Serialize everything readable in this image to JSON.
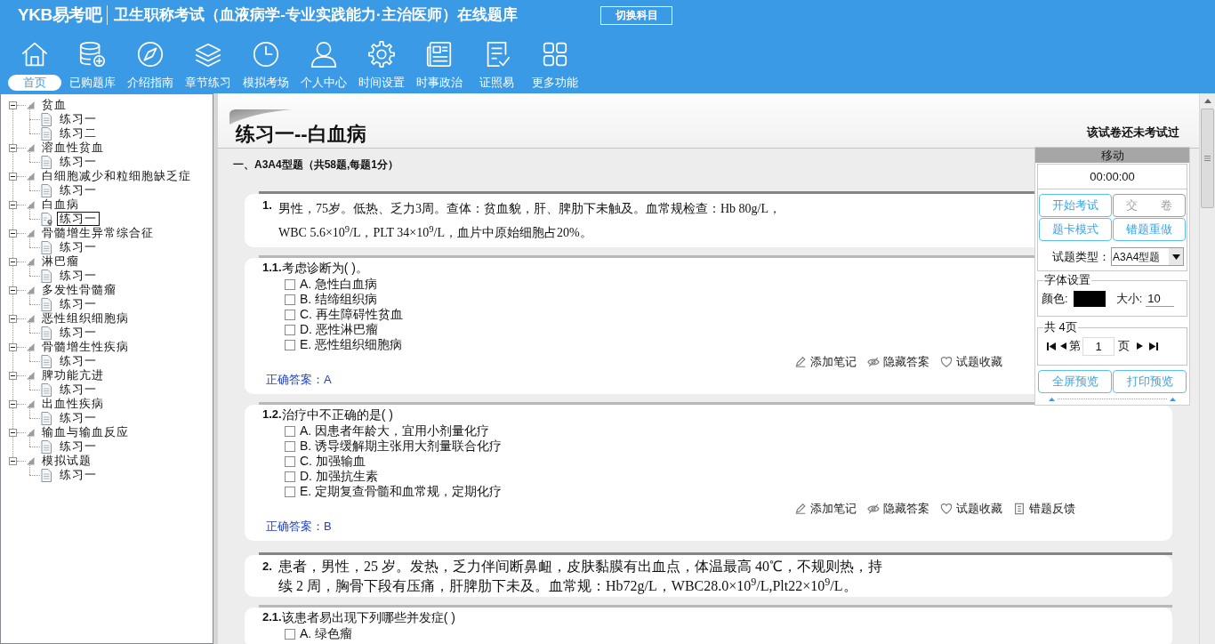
{
  "header": {
    "logo": "YKB易考吧",
    "title": "卫生职称考试（血液病学-专业实践能力·主治医师）在线题库",
    "switch_button": "切换科目"
  },
  "nav": [
    {
      "label": "首页",
      "selected": true
    },
    {
      "label": "已购题库",
      "selected": false
    },
    {
      "label": "介绍指南",
      "selected": false
    },
    {
      "label": "章节练习",
      "selected": false
    },
    {
      "label": "模拟考场",
      "selected": false
    },
    {
      "label": "个人中心",
      "selected": false
    },
    {
      "label": "时间设置",
      "selected": false
    },
    {
      "label": "时事政治",
      "selected": false
    },
    {
      "label": "证照易",
      "selected": false
    },
    {
      "label": "更多功能",
      "selected": false
    }
  ],
  "tree": [
    {
      "label": "贫血",
      "expanded": true,
      "children": [
        {
          "label": "练习一",
          "selected": false
        },
        {
          "label": "练习二",
          "selected": false
        }
      ]
    },
    {
      "label": "溶血性贫血",
      "expanded": true,
      "children": [
        {
          "label": "练习一",
          "selected": false
        }
      ]
    },
    {
      "label": "白细胞减少和粒细胞缺乏症",
      "expanded": true,
      "children": [
        {
          "label": "练习一",
          "selected": false
        }
      ]
    },
    {
      "label": "白血病",
      "expanded": true,
      "children": [
        {
          "label": "练习一",
          "selected": true
        }
      ]
    },
    {
      "label": "骨髓增生异常综合征",
      "expanded": true,
      "children": [
        {
          "label": "练习一",
          "selected": false
        }
      ]
    },
    {
      "label": "淋巴瘤",
      "expanded": true,
      "children": [
        {
          "label": "练习一",
          "selected": false
        }
      ]
    },
    {
      "label": "多发性骨髓瘤",
      "expanded": true,
      "children": [
        {
          "label": "练习一",
          "selected": false
        }
      ]
    },
    {
      "label": "恶性组织细胞病",
      "expanded": true,
      "children": [
        {
          "label": "练习一",
          "selected": false
        }
      ]
    },
    {
      "label": "骨髓增生性疾病",
      "expanded": true,
      "children": [
        {
          "label": "练习一",
          "selected": false
        }
      ]
    },
    {
      "label": "脾功能亢进",
      "expanded": true,
      "children": [
        {
          "label": "练习一",
          "selected": false
        }
      ]
    },
    {
      "label": "出血性疾病",
      "expanded": true,
      "children": [
        {
          "label": "练习一",
          "selected": false
        }
      ]
    },
    {
      "label": "输血与输血反应",
      "expanded": true,
      "children": [
        {
          "label": "练习一",
          "selected": false
        }
      ]
    },
    {
      "label": "模拟试题",
      "expanded": true,
      "children": [
        {
          "label": "练习一",
          "selected": false
        }
      ]
    }
  ],
  "exam": {
    "title": "练习一--白血病",
    "status": "该试卷还未考试过",
    "section": "一、A3A4型题（共58题,每题1分）",
    "questions": [
      {
        "kind": "case",
        "number": "1.",
        "text": "男性，75岁。低热、乏力3周。查体：贫血貌，肝、脾肋下未触及。血常规检查：Hb 80g/L，WBC 5.6×10$^{9}$/L，PLT 34×10$^{9}$/L，血片中原始细胞占20%。"
      },
      {
        "kind": "choice",
        "number": "1.1.",
        "stem": "考虑诊断为( )。",
        "options": [
          {
            "text": "A. 急性白血病",
            "checked": false
          },
          {
            "text": "B. 结缔组织病",
            "checked": false
          },
          {
            "text": "C. 再生障碍性贫血",
            "checked": false
          },
          {
            "text": "D. 恶性淋巴瘤",
            "checked": false
          },
          {
            "text": "E. 恶性组织细胞病",
            "checked": false
          }
        ],
        "actions": [
          "添加笔记",
          "隐藏答案",
          "试题收藏"
        ],
        "answer": "正确答案：A"
      },
      {
        "kind": "choice",
        "number": "1.2.",
        "stem": "治疗中不正确的是( )",
        "options": [
          {
            "text": "A. 因患者年龄大，宜用小剂量化疗",
            "checked": false
          },
          {
            "text": "B. 诱导缓解期主张用大剂量联合化疗",
            "checked": false
          },
          {
            "text": "C. 加强输血",
            "checked": false
          },
          {
            "text": "D. 加强抗生素",
            "checked": false
          },
          {
            "text": "E. 定期复查骨髓和血常规，定期化疗",
            "checked": false
          }
        ],
        "actions": [
          "添加笔记",
          "隐藏答案",
          "试题收藏",
          "错题反馈"
        ],
        "answer": "正确答案：B"
      },
      {
        "kind": "case",
        "number": "2.",
        "text": "患者，男性，25 岁。发热，乏力伴间断鼻衄，皮肤黏膜有出血点，体温最高 40℃，不规则热，持续 2 周，胸骨下段有压痛，肝脾肋下未及。血常规：Hb72g/L，WBC28.0×10$^{9}$/L,Plt22×10$^{9}$/L。"
      },
      {
        "kind": "choice",
        "number": "2.1.",
        "stem": "该患者易出现下列哪些并发症( )",
        "options": [
          {
            "text": "A. 绿色瘤",
            "checked": false
          }
        ]
      }
    ]
  },
  "panel": {
    "handle": "移动",
    "timer": "00:00:00",
    "buttons": [
      {
        "label": "开始考试",
        "disabled": false
      },
      {
        "label": "交　　卷",
        "disabled": true
      },
      {
        "label": "题卡模式",
        "disabled": false
      },
      {
        "label": "错题重做",
        "disabled": false
      }
    ],
    "type_label": "试题类型：",
    "type_value": "A3A4型题",
    "font": {
      "legend": "字体设置",
      "color_label": "颜色:",
      "color": "#000000",
      "size_label": "大小:",
      "size": "10"
    },
    "pager": {
      "legend": "共 4页",
      "before": "第",
      "page": "1",
      "after": "页"
    },
    "previews": [
      "全屏预览",
      "打印预览"
    ]
  }
}
